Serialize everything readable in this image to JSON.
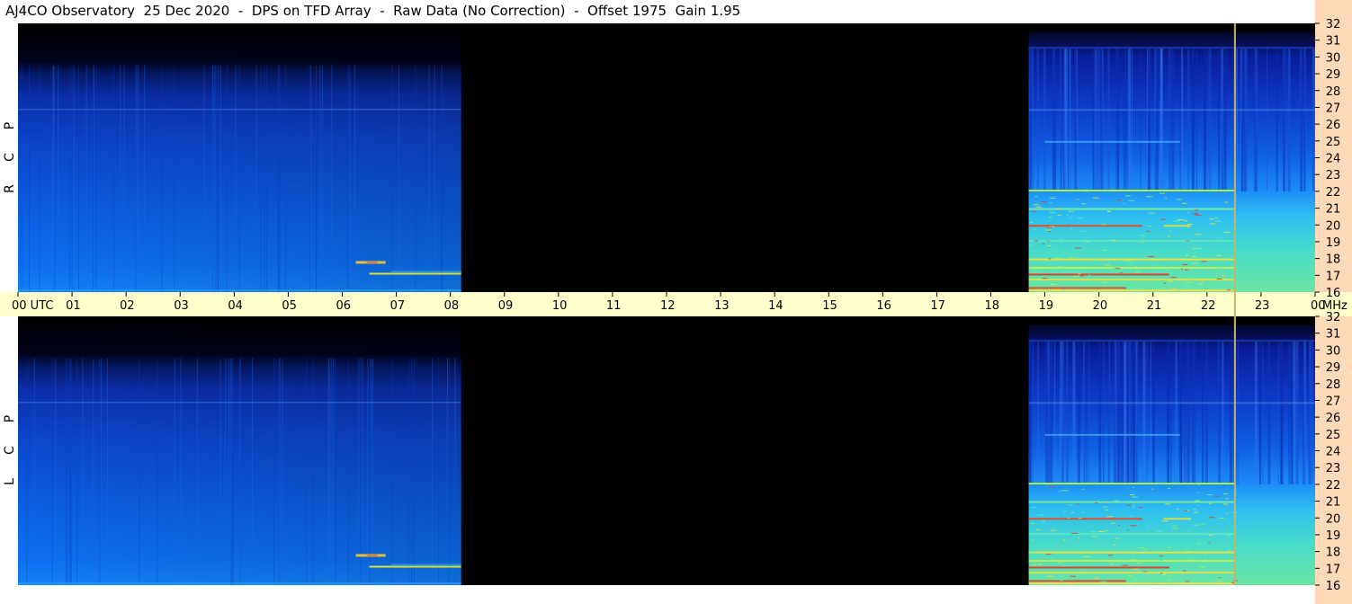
{
  "title": "AJ4CO Observatory  25 Dec 2020  -  DPS on TFD Array  -  Raw Data (No Correction)  -  Offset 1975  Gain 1.95",
  "chart_data": {
    "type": "heatmap",
    "panels": [
      {
        "channel": "RCP",
        "letters": [
          "R",
          "C",
          "P"
        ]
      },
      {
        "channel": "LCP",
        "letters": [
          "L",
          "C",
          "P"
        ]
      }
    ],
    "x": {
      "unit": "UTC",
      "ticks": [
        "00 UTC",
        "01",
        "02",
        "03",
        "04",
        "05",
        "06",
        "07",
        "08",
        "09",
        "10",
        "11",
        "12",
        "13",
        "14",
        "15",
        "16",
        "17",
        "18",
        "19",
        "20",
        "21",
        "22",
        "23",
        "00"
      ],
      "range_hours": [
        0,
        24
      ]
    },
    "y": {
      "unit": "MHz",
      "ticks": [
        16,
        17,
        18,
        19,
        20,
        21,
        22,
        23,
        24,
        25,
        26,
        27,
        28,
        29,
        30,
        31,
        32
      ],
      "range_mhz": [
        16,
        32
      ]
    },
    "data_segments_utc": [
      {
        "start": 0.0,
        "end": 8.2
      },
      {
        "start": 18.7,
        "end": 24.0
      }
    ],
    "no_data_utc": {
      "start": 8.2,
      "end": 18.7
    },
    "vertical_marker_utc": 22.5,
    "colors": {
      "background": "#000000",
      "axis_strip": "#ffffcc",
      "y_axis_strip": "#ffdab8",
      "marker": "#c8b464"
    },
    "colormap": "black-blue-cyan-yellow-red"
  }
}
